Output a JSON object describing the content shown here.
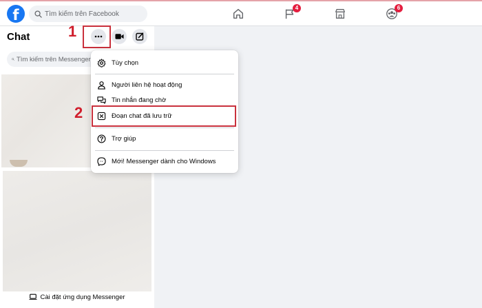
{
  "topbar": {
    "logo_letter": "f",
    "search_placeholder": "Tìm kiếm trên Facebook",
    "nav": [
      {
        "name": "home-icon",
        "badge": ""
      },
      {
        "name": "flag-icon",
        "badge": "4"
      },
      {
        "name": "marketplace-icon",
        "badge": ""
      },
      {
        "name": "groups-icon",
        "badge": "6"
      }
    ]
  },
  "chat": {
    "title": "Chat",
    "search_placeholder": "Tìm kiếm trên Messenger",
    "install_label": "Cài đặt ứng dụng Messenger"
  },
  "menu": {
    "items": [
      {
        "icon": "gear-icon",
        "label": "Tùy chọn"
      },
      {
        "icon": "person-icon",
        "label": "Người liên hệ hoạt động"
      },
      {
        "icon": "chat-bubbles-icon",
        "label": "Tin nhắn đang chờ"
      },
      {
        "icon": "archive-x-icon",
        "label": "Đoạn chat đã lưu trữ"
      },
      {
        "icon": "help-icon",
        "label": "Trợ giúp"
      },
      {
        "icon": "messenger-icon",
        "label": "Mới! Messenger dành cho Windows"
      }
    ]
  },
  "annotations": {
    "step1": "1",
    "step2": "2",
    "color": "#d01e2c"
  },
  "colors": {
    "brand": "#1877f2",
    "badge": "#e41e3f",
    "background": "#f0f2f5"
  }
}
